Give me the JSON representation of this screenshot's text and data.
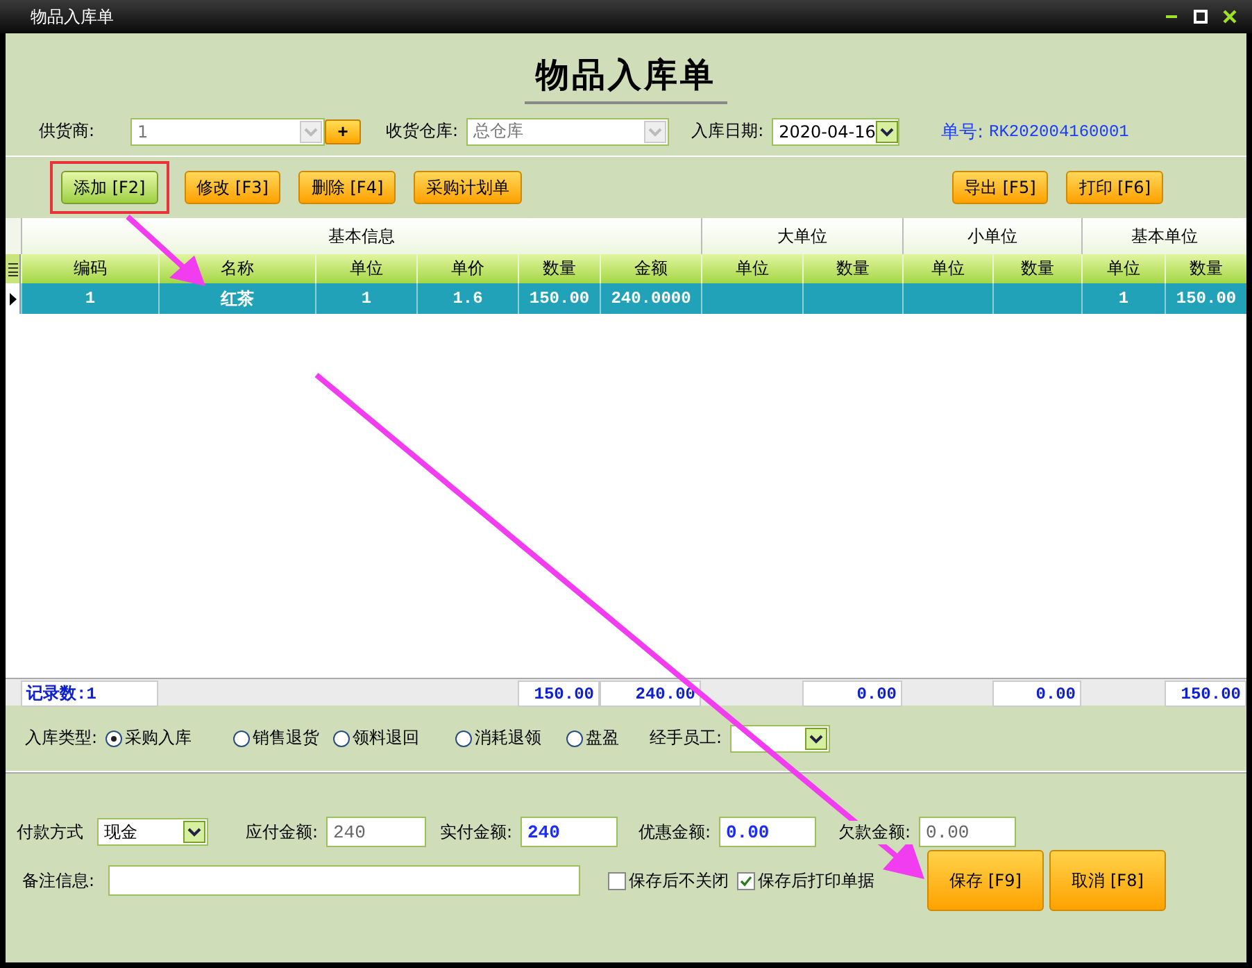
{
  "window": {
    "title": "物品入库单"
  },
  "form_title": "物品入库单",
  "header_fields": {
    "supplier": {
      "label": "供货商:",
      "value": "1",
      "add_button": "+"
    },
    "warehouse": {
      "label": "收货仓库:",
      "value": "总仓库"
    },
    "date": {
      "label": "入库日期:",
      "value": "2020-04-16"
    },
    "order_no": {
      "label": "单号:",
      "value": "RK202004160001"
    }
  },
  "toolbar": {
    "left": [
      {
        "label": "添加 [F2]",
        "highlighted": true
      },
      {
        "label": "修改 [F3]",
        "highlighted": false
      },
      {
        "label": "删除 [F4]",
        "highlighted": false
      },
      {
        "label": "采购计划单",
        "highlighted": false
      }
    ],
    "right": [
      {
        "label": "导出 [F5]",
        "highlighted": false
      },
      {
        "label": "打印 [F6]",
        "highlighted": false
      }
    ]
  },
  "table": {
    "groups": [
      {
        "label": "基本信息",
        "columns": [
          "编码",
          "名称",
          "单位",
          "单价",
          "数量",
          "金额"
        ]
      },
      {
        "label": "大单位",
        "columns": [
          "单位",
          "数量"
        ]
      },
      {
        "label": "小单位",
        "columns": [
          "单位",
          "数量"
        ]
      },
      {
        "label": "基本单位",
        "columns": [
          "单位",
          "数量"
        ]
      }
    ],
    "rows": [
      {
        "selected": true,
        "cells": [
          "1",
          "红茶",
          "1",
          "1.6",
          "150.00",
          "240.0000",
          null,
          null,
          null,
          null,
          "1",
          "150.00"
        ]
      }
    ],
    "footer": {
      "record_count": "记录数:1",
      "totals": [
        "150.00",
        "240.00",
        "0.00",
        "0.00",
        "150.00"
      ]
    }
  },
  "inbound_type": {
    "label": "入库类型:",
    "options": [
      {
        "label": "采购入库",
        "selected": true
      },
      {
        "label": "销售退货",
        "selected": false
      },
      {
        "label": "领料退回",
        "selected": false
      },
      {
        "label": "消耗退领",
        "selected": false
      },
      {
        "label": "盘盈",
        "selected": false
      }
    ]
  },
  "handler": {
    "label": "经手员工:"
  },
  "payment": {
    "method": {
      "label": "付款方式",
      "value": "现金"
    },
    "fields": [
      {
        "label": "应付金额:",
        "value": "240",
        "disabled": true
      },
      {
        "label": "实付金额:",
        "value": "240",
        "disabled": false
      },
      {
        "label": "优惠金额:",
        "value": "0.00",
        "disabled": false
      },
      {
        "label": "欠款金额:",
        "value": "0.00",
        "disabled": true
      }
    ]
  },
  "remarks": {
    "label": "备注信息:"
  },
  "options": [
    {
      "label": "保存后不关闭",
      "checked": false
    },
    {
      "label": "保存后打印单据",
      "checked": true
    }
  ],
  "actions": [
    "保存 [F9]",
    "取消 [F8]"
  ]
}
